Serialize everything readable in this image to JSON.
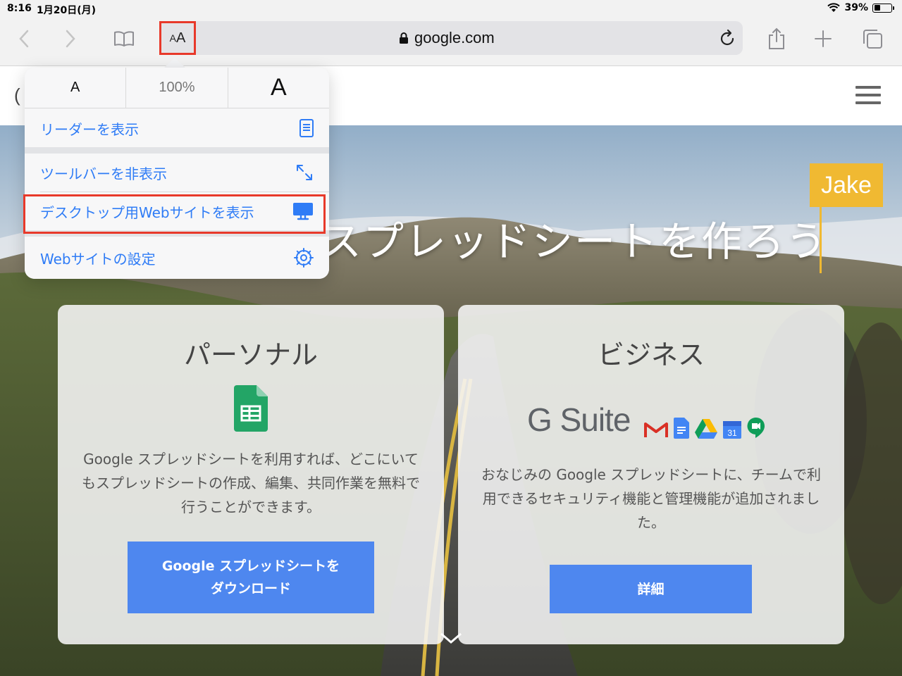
{
  "status_bar": {
    "time": "8:16",
    "date": "1月20日(月)",
    "battery": "39%",
    "battery_level": 0.39
  },
  "toolbar": {
    "url": "google.com",
    "text_size_small": "A",
    "text_size_big": "A",
    "icons": [
      "back-icon",
      "forward-icon",
      "bookmarks-icon",
      "text-size-icon",
      "lock-icon",
      "reload-icon",
      "share-icon",
      "new-tab-icon",
      "tabs-icon"
    ]
  },
  "popover": {
    "zoom_small": "A",
    "zoom_percent": "100%",
    "zoom_big": "A",
    "items": [
      {
        "label": "リーダーを表示",
        "icon": "reader-icon"
      },
      {
        "label": "ツールバーを非表示",
        "icon": "expand-arrows-icon"
      },
      {
        "label": "デスクトップ用Webサイトを表示",
        "icon": "desktop-icon"
      },
      {
        "label": "Webサイトの設定",
        "icon": "gear-icon"
      }
    ]
  },
  "page": {
    "header_partial": "(",
    "hero_title": "スプレッドシートを作ろう",
    "hero_tag": "Jake",
    "personal": {
      "title": "パーソナル",
      "description": "Google スプレッドシートを利用すれば、どこにいてもスプレッドシートの作成、編集、共同作業を無料で行うことができます。",
      "button": "Google スプレッドシートをダウンロード"
    },
    "business": {
      "title": "ビジネス",
      "brand": "G Suite",
      "calendar_day": "31",
      "description": "おなじみの Google スプレッドシートに、チームで利用できるセキュリティ機能と管理機能が追加されました。",
      "button": "詳細"
    }
  },
  "colors": {
    "accent_blue": "#2f7cf6",
    "button_blue": "#4e87ef",
    "highlight_red": "#e8392a",
    "tag_yellow": "#f0b932"
  }
}
